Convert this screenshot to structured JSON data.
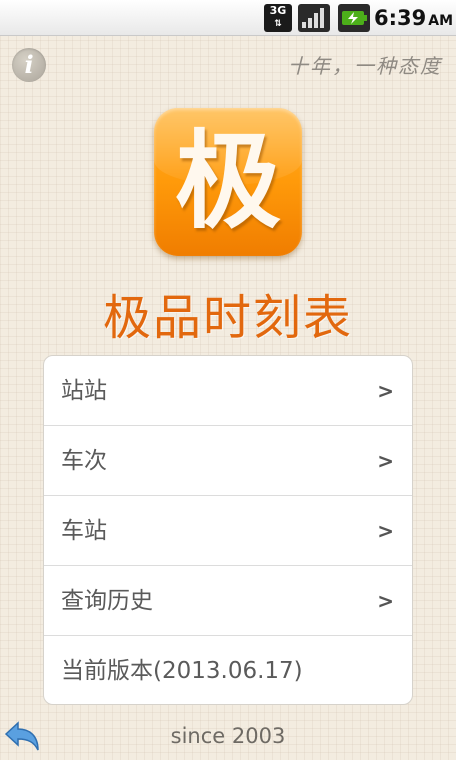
{
  "status_bar": {
    "network": "3G",
    "network_arrows": "⇅",
    "time": "6:39",
    "ampm": "AM",
    "signal_icon": "signal-bars-icon",
    "battery_icon": "battery-charging-icon"
  },
  "header": {
    "info_icon": "info-icon",
    "info_glyph": "i",
    "slogan": "十年，一种态度"
  },
  "app": {
    "icon_glyph": "极",
    "title": "极品时刻表"
  },
  "menu": {
    "items": [
      {
        "label": "站站",
        "arrow": ">"
      },
      {
        "label": "车次",
        "arrow": ">"
      },
      {
        "label": "车站",
        "arrow": ">"
      },
      {
        "label": "查询历史",
        "arrow": ">"
      },
      {
        "label": "当前版本(2013.06.17)"
      }
    ]
  },
  "footer": {
    "back_icon": "back-arrow-icon",
    "text": "since 2003"
  },
  "colors": {
    "accent": "#e2680e",
    "icon_orange": "#ff9a0a",
    "background": "#f3ece0"
  }
}
